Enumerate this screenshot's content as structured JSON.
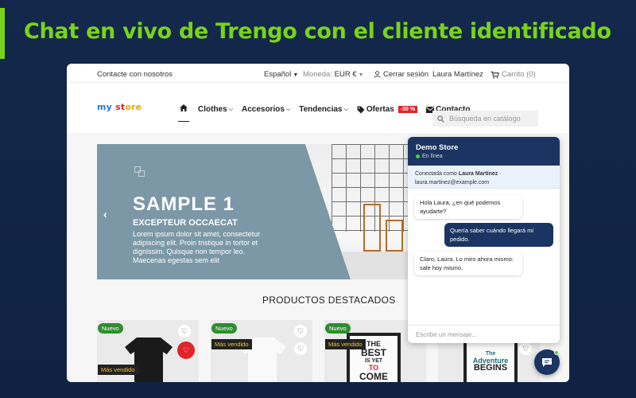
{
  "headline": "Chat en vivo de Trengo con el cliente identificado",
  "colors": {
    "accent": "#79d31c",
    "background": "#13284a",
    "chat_header": "#1b3461",
    "sale": "#e4222b",
    "new_badge": "#2d8e2d"
  },
  "topbar": {
    "contact": "Contacte con nosotros",
    "language": "Español",
    "currency_label": "Moneda:",
    "currency_value": "EUR €",
    "logout": "Cerrar sesión",
    "user": "Laura Martínez",
    "cart": "Carrito (0)"
  },
  "logo": {
    "part1": "my",
    "part2": "st",
    "part3": "ore"
  },
  "nav": {
    "clothes": "Clothes",
    "accessories": "Accesorios",
    "trends": "Tendencias",
    "offers": "Ofertas",
    "offers_badge": "-30 %",
    "contact": "Contacto"
  },
  "search": {
    "placeholder": "Búsqueda en catálogo"
  },
  "slider": {
    "title": "SAMPLE 1",
    "subtitle": "EXCEPTEUR OCCAECAT",
    "description": "Lorem ipsum dolor sit amet, consectetur adipiscing elit. Proin tristique in tortor et dignissim. Quisque non tempor leo. Maecenas egestas sem elit"
  },
  "featured_title": "PRODUCTOS DESTACADOS",
  "products": [
    {
      "badge_new": "Nuevo",
      "badge_best": "Más vendido"
    },
    {
      "badge_new": "Nuevo",
      "badge_best": "Más vendido"
    },
    {
      "badge_new": "Nuevo",
      "badge_best": "Más vendido",
      "poster_lines": [
        "THE",
        "BEST",
        "IS YET",
        "TO",
        "COME"
      ]
    },
    {
      "poster_lines": [
        "The",
        "Adventure",
        "BEGINS"
      ]
    }
  ],
  "chat": {
    "store_name": "Demo Store",
    "status": "En línea",
    "ident_prefix": "Conectada como",
    "ident_name": "Laura Martínez",
    "ident_sep": "·",
    "ident_email": "laura.martinez@example.com",
    "messages": [
      {
        "from": "agent",
        "text": "Hola Laura, ¿en qué podemos ayudarte?"
      },
      {
        "from": "user",
        "text": "Quería saber cuándo llegará mi pedido."
      },
      {
        "from": "agent",
        "text": "Claro, Laura. Lo miro ahora mismo: sale hoy mismo."
      }
    ],
    "input_placeholder": "Escribe un mensaje..."
  }
}
